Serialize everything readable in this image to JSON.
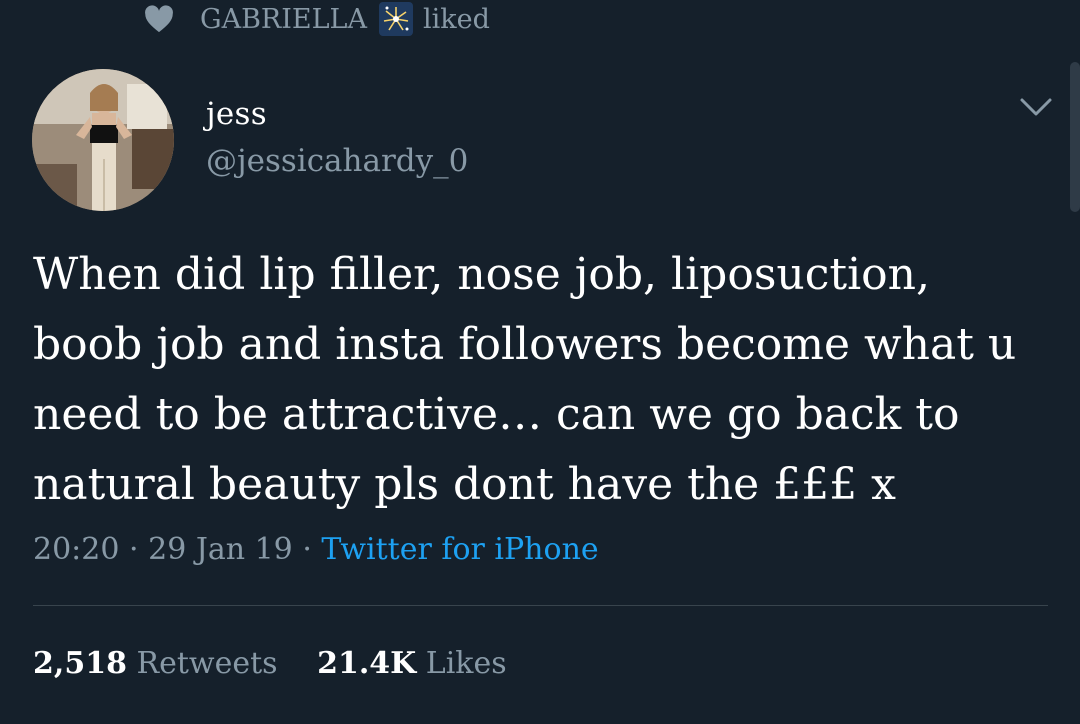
{
  "social_context": {
    "name": "GABRIELLA",
    "action": "liked",
    "icons": [
      "heart-icon",
      "firework-emoji-icon"
    ]
  },
  "author": {
    "display_name": "jess",
    "handle": "@jessicahardy_0"
  },
  "tweet": {
    "text": "When did lip filler, nose job, liposuction, boob job and insta followers become what u need to be attractive… can we go back to natural beauty pls dont have the £££ x"
  },
  "meta": {
    "time": "20:20",
    "date": "29 Jan 19",
    "separator": "·",
    "source": "Twitter for iPhone"
  },
  "stats": {
    "retweets_count": "2,518",
    "retweets_label": "Retweets",
    "likes_count": "21.4K",
    "likes_label": "Likes"
  },
  "colors": {
    "background": "#15202b",
    "secondary_text": "#8899a6",
    "link": "#1da1f2",
    "divider": "#38444d"
  }
}
